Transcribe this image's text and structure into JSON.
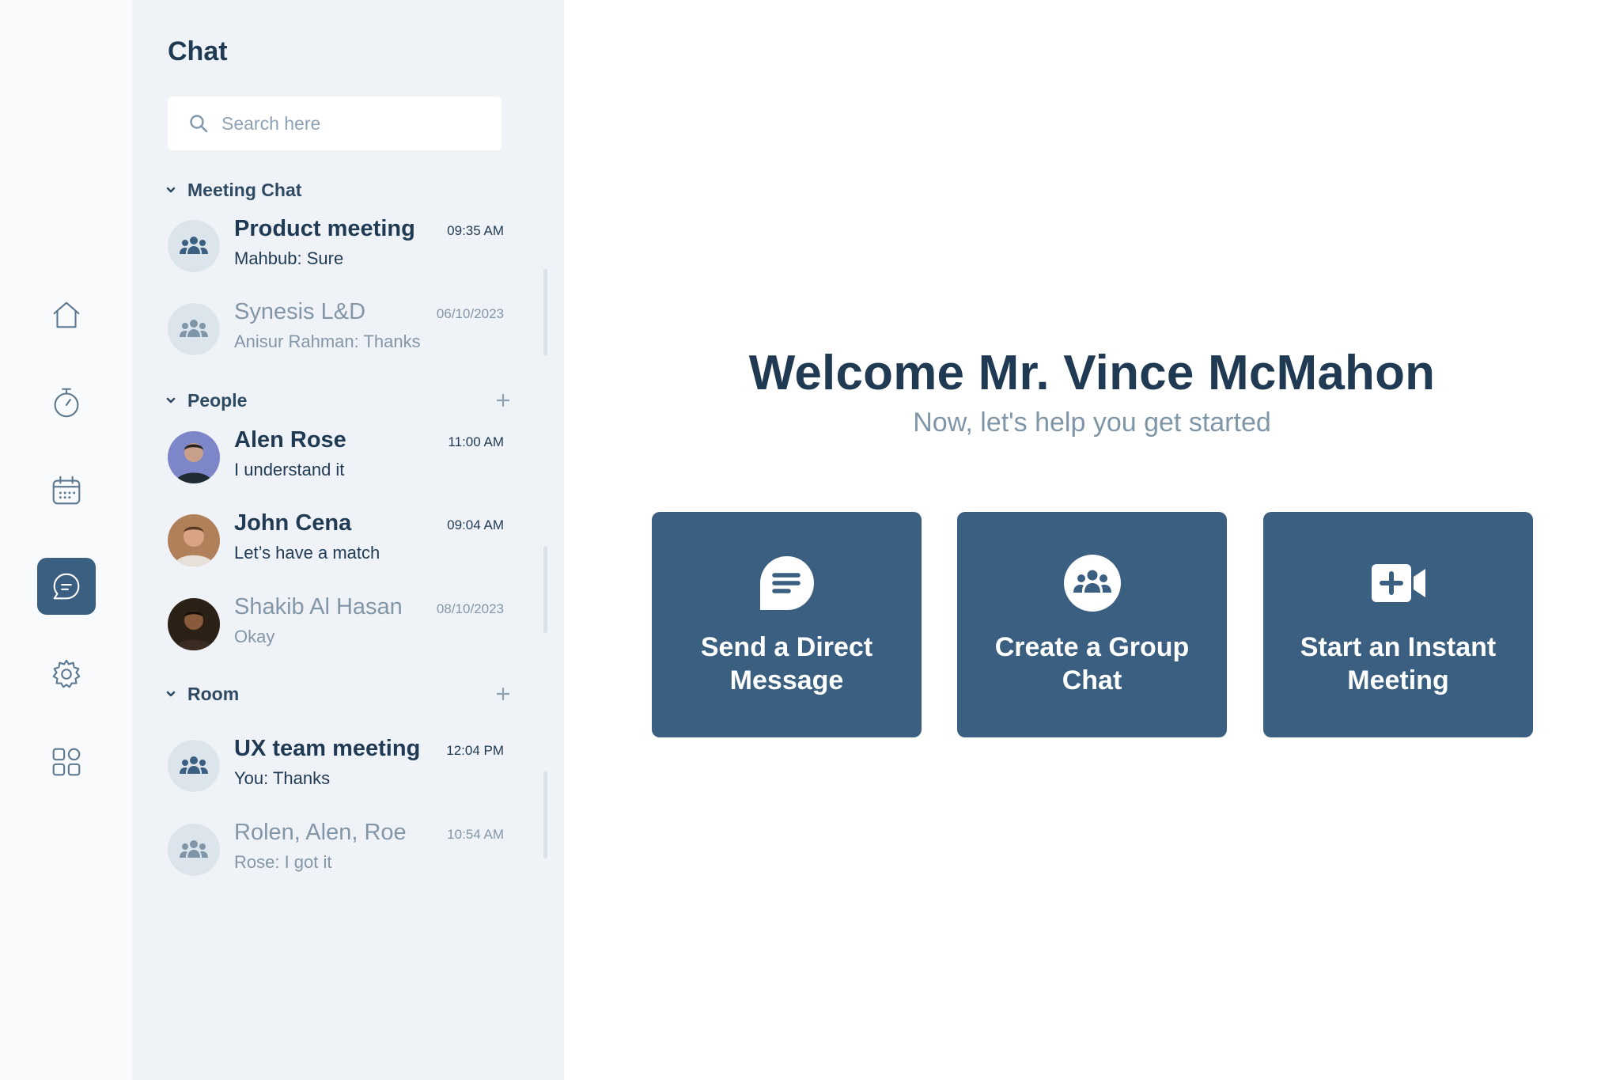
{
  "nav": {
    "items": [
      {
        "id": "home",
        "icon": "home-icon"
      },
      {
        "id": "timer",
        "icon": "stopwatch-icon"
      },
      {
        "id": "calendar",
        "icon": "calendar-icon"
      },
      {
        "id": "chat",
        "icon": "chat-icon",
        "active": true
      },
      {
        "id": "settings",
        "icon": "gear-icon"
      },
      {
        "id": "apps",
        "icon": "grid-icon"
      }
    ]
  },
  "sidebar": {
    "title": "Chat",
    "search_placeholder": "Search here",
    "sections": [
      {
        "label": "Meeting Chat",
        "items": [
          {
            "name": "Product meeting",
            "preview": "Mahbub: Sure",
            "time": "09:35 AM"
          },
          {
            "name": "Synesis L&D",
            "preview": "Anisur Rahman: Thanks",
            "time": "06/10/2023"
          }
        ]
      },
      {
        "label": "People",
        "items": [
          {
            "name": "Alen Rose",
            "preview": "I understand it",
            "time": "11:00 AM"
          },
          {
            "name": "John Cena",
            "preview": "Let’s have a match",
            "time": "09:04 AM"
          },
          {
            "name": "Shakib Al Hasan",
            "preview": "Okay",
            "time": "08/10/2023"
          }
        ]
      },
      {
        "label": "Room",
        "items": [
          {
            "name": "UX team meeting",
            "preview": "You: Thanks",
            "time": "12:04 PM"
          },
          {
            "name": "Rolen, Alen, Roe",
            "preview": "Rose: I got it",
            "time": "10:54 AM"
          }
        ]
      }
    ]
  },
  "main": {
    "welcome": "Welcome Mr. Vince McMahon",
    "subtitle": "Now, let's help you get started",
    "cards": [
      {
        "label": "Send a Direct Message",
        "icon": "message-icon"
      },
      {
        "label": "Create a Group Chat",
        "icon": "group-icon"
      },
      {
        "label": "Start an Instant Meeting",
        "icon": "video-plus-icon"
      }
    ]
  },
  "colors": {
    "accent": "#3a5f80",
    "sidebar_bg": "#eff3f7",
    "rail_bg": "#f8fafc",
    "text_dark": "#1f3a52",
    "text_muted": "#8396a8"
  }
}
